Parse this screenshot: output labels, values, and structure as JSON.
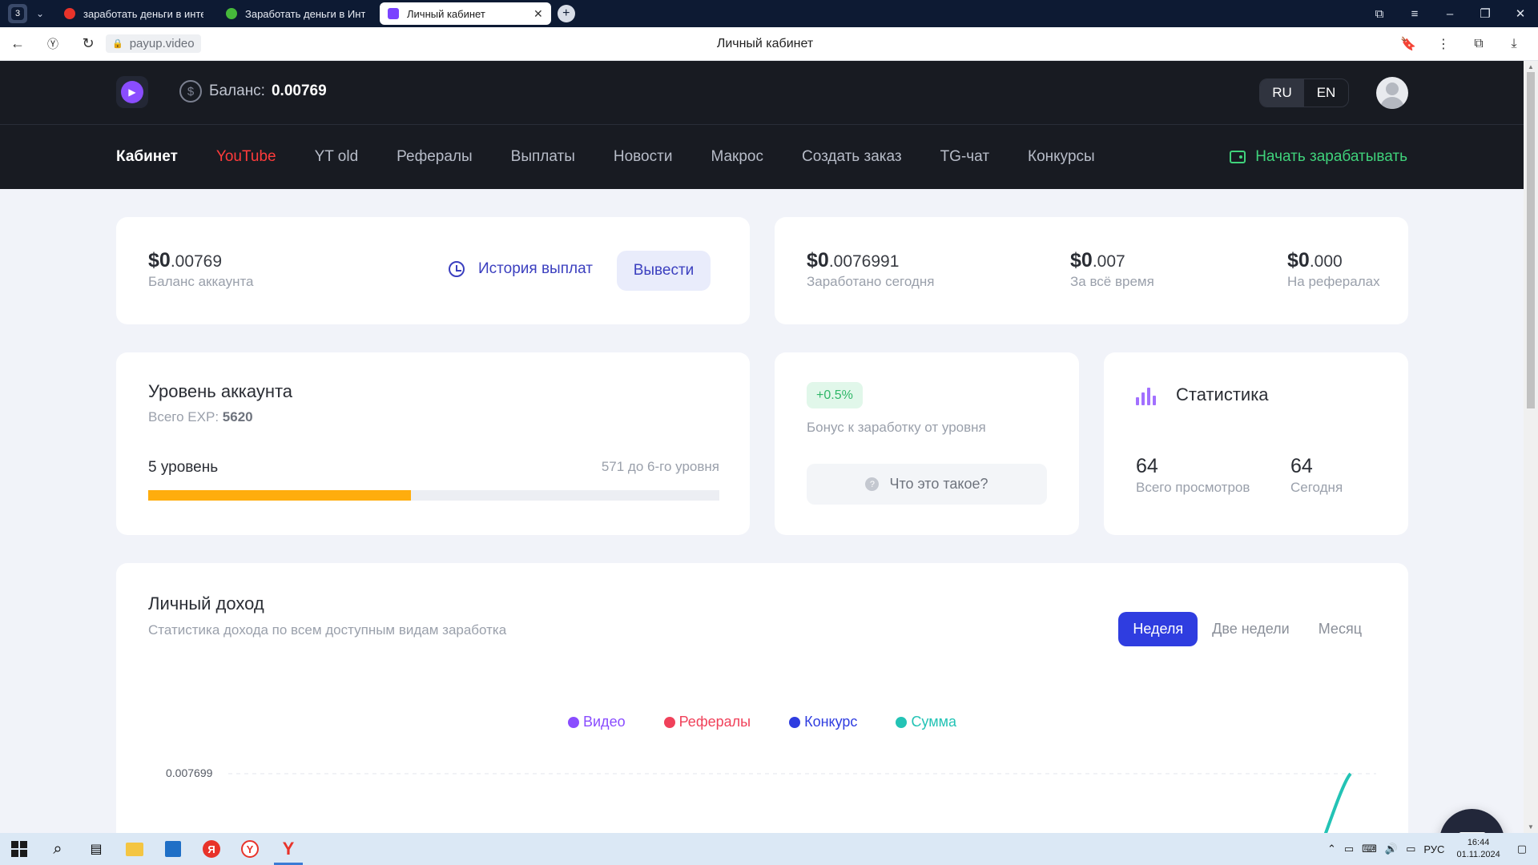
{
  "browser": {
    "tab_count": "3",
    "tabs": [
      {
        "title": "заработать деньги в инте",
        "color": "#e8332a"
      },
      {
        "title": "Заработать деньги в Инте",
        "color": "#46b93b"
      },
      {
        "title": "Личный кабинет",
        "color": "#7a43ff"
      }
    ],
    "url": "payup.video",
    "page_title": "Личный кабинет"
  },
  "header": {
    "balance_label": "Баланс:",
    "balance_value": "0.00769",
    "lang": [
      "RU",
      "EN"
    ]
  },
  "menu": {
    "items": [
      "Кабинет",
      "YouTube",
      "YT old",
      "Рефералы",
      "Выплаты",
      "Новости",
      "Макрос",
      "Создать заказ",
      "TG-чат",
      "Конкурсы"
    ],
    "earn_label": "Начать зарабатывать"
  },
  "balance_card": {
    "amount_int": "$0",
    "amount_frac": ".00769",
    "label": "Баланс аккаунта",
    "history_label": "История выплат",
    "withdraw_label": "Вывести"
  },
  "earnings_card": {
    "cols": [
      {
        "int": "$0",
        "frac": ".0076991",
        "label": "Заработано сегодня"
      },
      {
        "int": "$0",
        "frac": ".007",
        "label": "За всё время"
      },
      {
        "int": "$0",
        "frac": ".000",
        "label": "На рефералах"
      }
    ]
  },
  "level_card": {
    "title": "Уровень аккаунта",
    "exp_label": "Всего EXP:",
    "exp_value": "5620",
    "level_label": "5 уровень",
    "next_label": "571 до 6-го уровня",
    "progress": 0.46
  },
  "bonus_card": {
    "badge": "+0.5%",
    "desc": "Бонус к заработку от уровня",
    "what_label": "Что это такое?"
  },
  "stats_card": {
    "title": "Статистика",
    "cols": [
      {
        "value": "64",
        "label": "Всего просмотров"
      },
      {
        "value": "64",
        "label": "Сегодня"
      }
    ]
  },
  "income_card": {
    "title": "Личный доход",
    "desc": "Статистика дохода по всем доступным видам заработка",
    "periods": [
      "Неделя",
      "Две недели",
      "Месяц"
    ],
    "legend": [
      {
        "name": "Видео",
        "color": "#8a4dff"
      },
      {
        "name": "Рефералы",
        "color": "#f0415a"
      },
      {
        "name": "Конкурс",
        "color": "#2f3de0"
      },
      {
        "name": "Сумма",
        "color": "#23c3b5"
      }
    ]
  },
  "chart_data": {
    "type": "line",
    "series": [
      {
        "name": "Сумма",
        "values": [
          0,
          0.007699
        ]
      }
    ],
    "ytick_top": "0.007699"
  },
  "taskbar": {
    "lang": "РУС",
    "time": "16:44",
    "date": "01.11.2024"
  }
}
